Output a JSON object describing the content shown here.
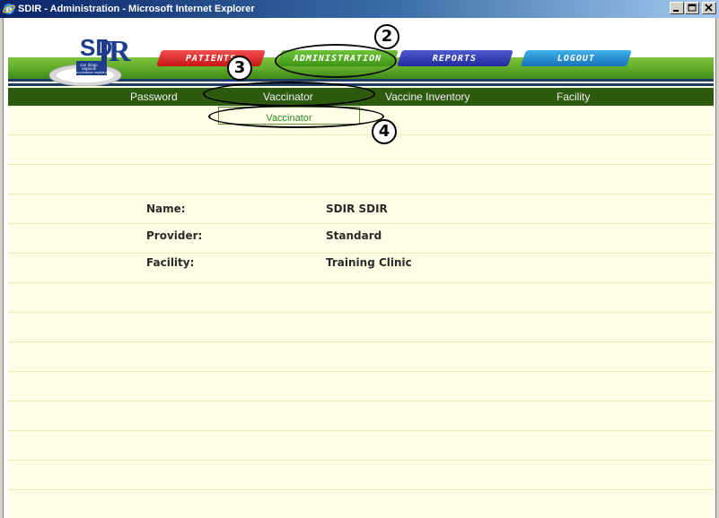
{
  "window": {
    "title": "SDIR - Administration - Microsoft Internet Explorer",
    "icon": "ie-icon",
    "controls": [
      "minimize-icon",
      "maximize-icon",
      "close-icon"
    ]
  },
  "header": {
    "logo_text": "SDiR",
    "logo_subtext": "san diego regional immunization registry",
    "tabs": [
      {
        "label": "PATIENTS",
        "color": "#d81e1e"
      },
      {
        "label": "ADMINISTRATION",
        "color": "#4ea624",
        "active": true
      },
      {
        "label": "REPORTS",
        "color": "#2f3aaf"
      },
      {
        "label": "LOGOUT",
        "color": "#2a8fd0"
      }
    ]
  },
  "subnav": {
    "items": [
      "Password",
      "Vaccinator",
      "Vaccine Inventory",
      "Facility"
    ],
    "dropdown_item": "Vaccinator"
  },
  "info": {
    "name_label": "Name:",
    "name_value": "SDIR SDIR",
    "provider_label": "Provider:",
    "provider_value": "Standard",
    "facility_label": "Facility:",
    "facility_value": "Training Clinic"
  },
  "annotations": {
    "marker_2": "2",
    "marker_3": "3",
    "marker_4": "4"
  },
  "colors": {
    "subnav_bg": "#2e5a10",
    "content_bg": "#ffffe8",
    "title_bar": "#0a246a"
  }
}
